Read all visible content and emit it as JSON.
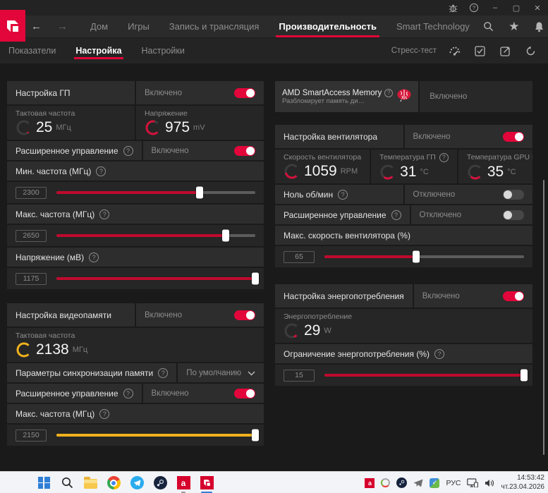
{
  "colors": {
    "accent": "#e2063a",
    "slider_red": "#c00a2e",
    "slider_yellow": "#f0b11c",
    "gauge_red": "#d2123c",
    "gauge_yellow": "#f0b11c",
    "logo_red": "#e4002b"
  },
  "titlebar": {
    "help_glyph": "?",
    "minimize_glyph": "–",
    "maximize_glyph": "▢",
    "close_glyph": "✕"
  },
  "nav": {
    "tabs": [
      {
        "label": "Дом"
      },
      {
        "label": "Игры"
      },
      {
        "label": "Запись и трансляция"
      },
      {
        "label": "Производительность"
      },
      {
        "label": "Smart Technology"
      }
    ]
  },
  "subnav": {
    "tabs": [
      {
        "label": "Показатели"
      },
      {
        "label": "Настройка"
      },
      {
        "label": "Настройки"
      }
    ],
    "stress_test_label": "Стресс-тест"
  },
  "labels": {
    "on": "Включено",
    "off": "Отключено",
    "help": "?"
  },
  "gpu": {
    "title": "Настройка ГП",
    "clock_label": "Тактовая частота",
    "clock_value": "25",
    "clock_unit": "МГц",
    "volt_label": "Напряжение",
    "volt_value": "975",
    "volt_unit": "mV",
    "adv_label": "Расширенное управление",
    "min_freq_label": "Мин. частота (МГц)",
    "min_freq_value": "2300",
    "max_freq_label": "Макс. частота (МГц)",
    "max_freq_value": "2650",
    "volt_mv_label": "Напряжение (мВ)",
    "volt_mv_value": "1175"
  },
  "vram": {
    "title": "Настройка видеопамяти",
    "clock_label": "Тактовая частота",
    "clock_value": "2138",
    "clock_unit": "МГц",
    "timing_label": "Параметры синхронизации памяти",
    "timing_value": "По умолчанию",
    "adv_label": "Расширенное управление",
    "max_freq_label": "Макс. частота (МГц)",
    "max_freq_value": "2150"
  },
  "sam": {
    "title": "AMD SmartAccess Memory",
    "subtitle": "Разблокирует память дискретного Г...",
    "status": "Включено"
  },
  "fan": {
    "title": "Настройка вентилятора",
    "speed_label": "Скорость вентилятора",
    "speed_value": "1059",
    "speed_unit": "RPM",
    "temp_label": "Температура ГП",
    "temp_value": "31",
    "temp_unit": "°C",
    "hotspot_label": "Температура GPU Hotspot",
    "hotspot_value": "35",
    "hotspot_unit": "°C",
    "zero_label": "Ноль об/мин",
    "adv_label": "Расширенное управление",
    "max_speed_label": "Макс. скорость вентилятора (%)",
    "max_speed_value": "65"
  },
  "power": {
    "title": "Настройка энергопотребления",
    "draw_label": "Энергопотребление",
    "draw_value": "29",
    "draw_unit": "W",
    "limit_label": "Ограничение энергопотребления (%)",
    "limit_value": "15"
  },
  "states": {
    "gpu_tuning": true,
    "gpu_adv": true,
    "vram_tuning": true,
    "vram_adv": true,
    "fan_tuning": true,
    "fan_zero": false,
    "fan_adv": false,
    "power_tuning": true
  },
  "gauges": {
    "gpu_clock": {
      "frac": 0.04,
      "color": "#d2123c"
    },
    "gpu_volt": {
      "frac": 0.88,
      "color": "#d2123c"
    },
    "vram_clock": {
      "frac": 1.0,
      "color": "#f0b11c"
    },
    "fan_speed": {
      "frac": 0.45,
      "color": "#d2123c"
    },
    "gpu_temp": {
      "frac": 0.3,
      "color": "#d2123c"
    },
    "hotspot": {
      "frac": 0.33,
      "color": "#d2123c"
    },
    "power_draw": {
      "frac": 0.1,
      "color": "#d2123c"
    }
  },
  "sliders": {
    "min_freq": 72,
    "max_freq": 85,
    "volt_mv": 100,
    "vram_max": 100,
    "fan_max": 46,
    "power_limit": 100
  },
  "taskbar": {
    "lang": "РУС",
    "time": "14:53:42",
    "date": "чт.23.04.2026"
  }
}
